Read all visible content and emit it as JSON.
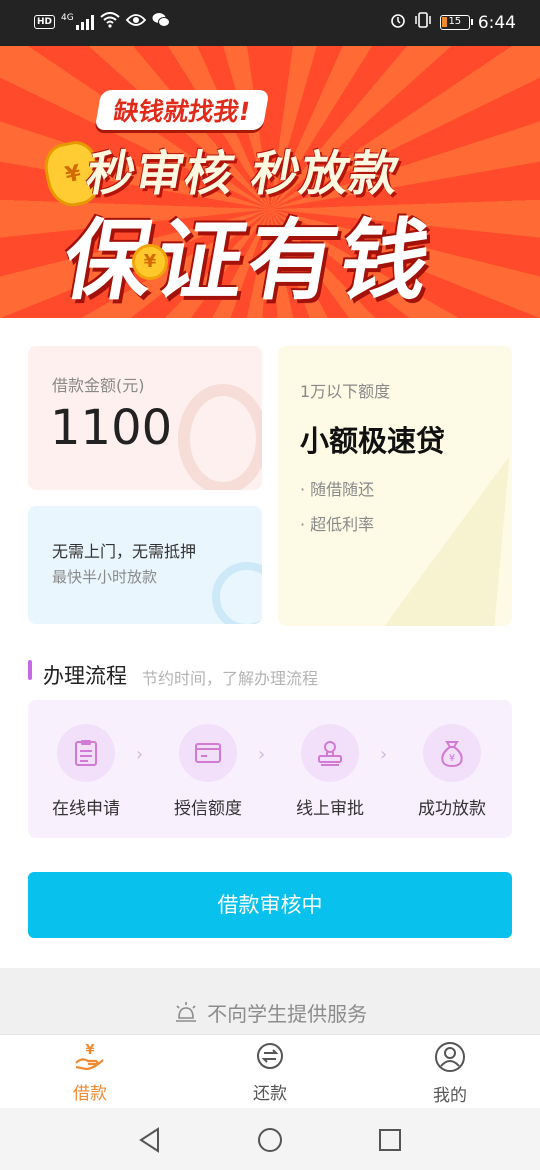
{
  "status_bar": {
    "hd": "HD",
    "net": "4G",
    "battery": "15",
    "time": "6:44"
  },
  "banner": {
    "badge": "缺钱就找我!",
    "line1": "秒审核 秒放款",
    "line2": "保证有钱",
    "coin_symbol": "¥"
  },
  "amount_card": {
    "label": "借款金额(元)",
    "value": "1100"
  },
  "no_visit_card": {
    "line1": "无需上门，无需抵押",
    "line2": "最快半小时放款"
  },
  "fast_card": {
    "subtitle": "1万以下额度",
    "title": "小额极速贷",
    "bullets": [
      "· 随借随还",
      "· 超低利率"
    ]
  },
  "process": {
    "title": "办理流程",
    "subtitle": "节约时间，了解办理流程",
    "arrow": "›",
    "steps": [
      {
        "label": "在线申请",
        "icon": "clipboard-icon"
      },
      {
        "label": "授信额度",
        "icon": "card-icon"
      },
      {
        "label": "线上审批",
        "icon": "stamp-icon"
      },
      {
        "label": "成功放款",
        "icon": "money-bag-icon"
      }
    ]
  },
  "primary_button": "借款审核中",
  "notice": "不向学生提供服务",
  "tabs": [
    {
      "label": "借款",
      "icon": "loan-icon",
      "active": true
    },
    {
      "label": "还款",
      "icon": "repay-icon",
      "active": false
    },
    {
      "label": "我的",
      "icon": "profile-icon",
      "active": false
    }
  ],
  "colors": {
    "accent": "#08c1ec",
    "tab_active": "#f08b33",
    "banner_red": "#ff4b2b",
    "process_purple": "#c46ae6"
  }
}
